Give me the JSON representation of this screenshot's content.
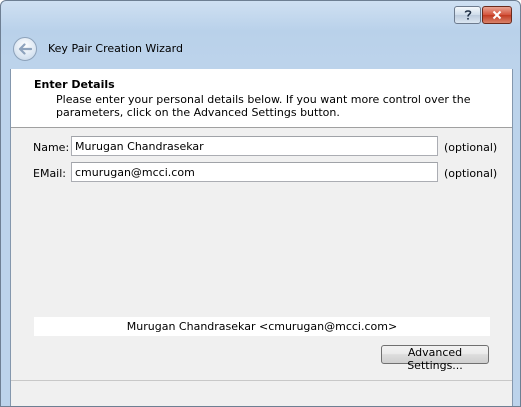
{
  "window": {
    "title": "Key Pair Creation Wizard",
    "help_label": "?",
    "close_label": "✕"
  },
  "header": {
    "title": "Enter Details",
    "description": "Please enter your personal details below. If you want more control over the parameters, click on the Advanced Settings button."
  },
  "form": {
    "name": {
      "label": "Name:",
      "value": "Murugan Chandrasekar",
      "hint": "(optional)"
    },
    "email": {
      "label": "EMail:",
      "value": "cmurugan@mcci.com",
      "hint": "(optional)"
    }
  },
  "summary": "Murugan Chandrasekar <cmurugan@mcci.com>",
  "buttons": {
    "advanced_settings": "Advanced Settings..."
  },
  "icons": {
    "back": "back-arrow-icon",
    "help": "help-icon",
    "close": "close-icon"
  },
  "colors": {
    "title_gradient_top": "#cfe0f2",
    "close_button": "#c23b22",
    "content_background": "#f0f0f0"
  }
}
